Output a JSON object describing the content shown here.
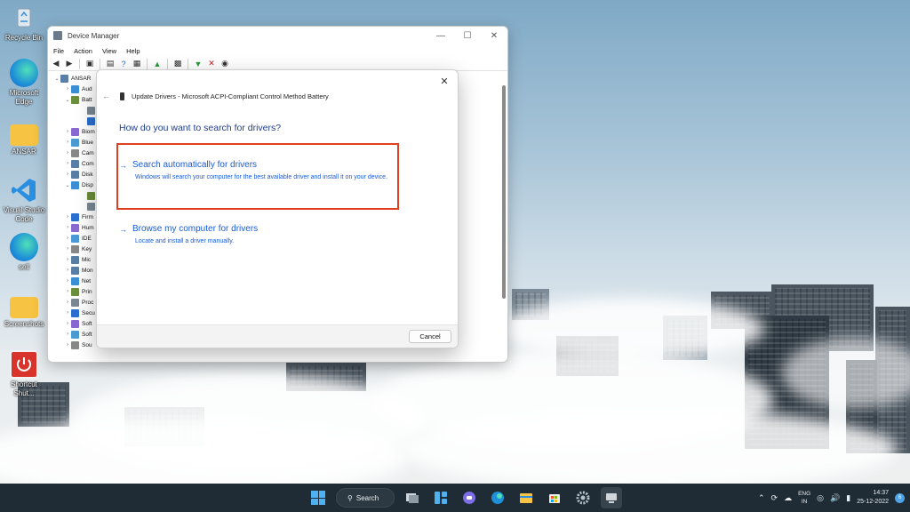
{
  "desktop": {
    "icons": [
      {
        "label": "Recycle Bin",
        "icon": "recycle-bin-icon"
      },
      {
        "label": "Microsoft Edge",
        "icon": "edge-icon"
      },
      {
        "label": "ANSAR",
        "icon": "folder-icon"
      },
      {
        "label": "Visual Studio Code",
        "icon": "vscode-icon"
      },
      {
        "label": "sell",
        "icon": "edge-icon"
      },
      {
        "label": "Screenshots",
        "icon": "folder-icon"
      },
      {
        "label": "Shortcut Shut...",
        "icon": "power-shortcut-icon"
      }
    ]
  },
  "device_manager": {
    "title": "Device Manager",
    "menu": [
      "File",
      "Action",
      "View",
      "Help"
    ],
    "tree": [
      {
        "label": "ANSAR",
        "expanded": true
      },
      {
        "label": "Aud"
      },
      {
        "label": "Batt",
        "expanded": true
      },
      {
        "label": ""
      },
      {
        "label": ""
      },
      {
        "label": "Biom"
      },
      {
        "label": "Blue"
      },
      {
        "label": "Cam"
      },
      {
        "label": "Com"
      },
      {
        "label": "Disk"
      },
      {
        "label": "Disp",
        "expanded": true
      },
      {
        "label": ""
      },
      {
        "label": ""
      },
      {
        "label": "Firm"
      },
      {
        "label": "Hum"
      },
      {
        "label": "IDE"
      },
      {
        "label": "Key"
      },
      {
        "label": "Mic"
      },
      {
        "label": "Mon"
      },
      {
        "label": "Net"
      },
      {
        "label": "Prin"
      },
      {
        "label": "Proc"
      },
      {
        "label": "Secu"
      },
      {
        "label": "Soft"
      },
      {
        "label": "Soft"
      },
      {
        "label": "Sou"
      }
    ]
  },
  "dialog": {
    "header": "Update Drivers - Microsoft ACPI-Compliant Control Method Battery",
    "question": "How do you want to search for drivers?",
    "options": [
      {
        "title": "Search automatically for drivers",
        "description": "Windows will search your computer for the best available driver and install it on your device."
      },
      {
        "title": "Browse my computer for drivers",
        "description": "Locate and install a driver manually."
      }
    ],
    "cancel_label": "Cancel",
    "highlight_color": "#e0401f",
    "accent_color": "#1a5bd6"
  },
  "taskbar": {
    "search_label": "Search",
    "language": "ENG",
    "region": "IN",
    "time": "14:37",
    "date": "25-12-2022",
    "notification_count": "6"
  }
}
